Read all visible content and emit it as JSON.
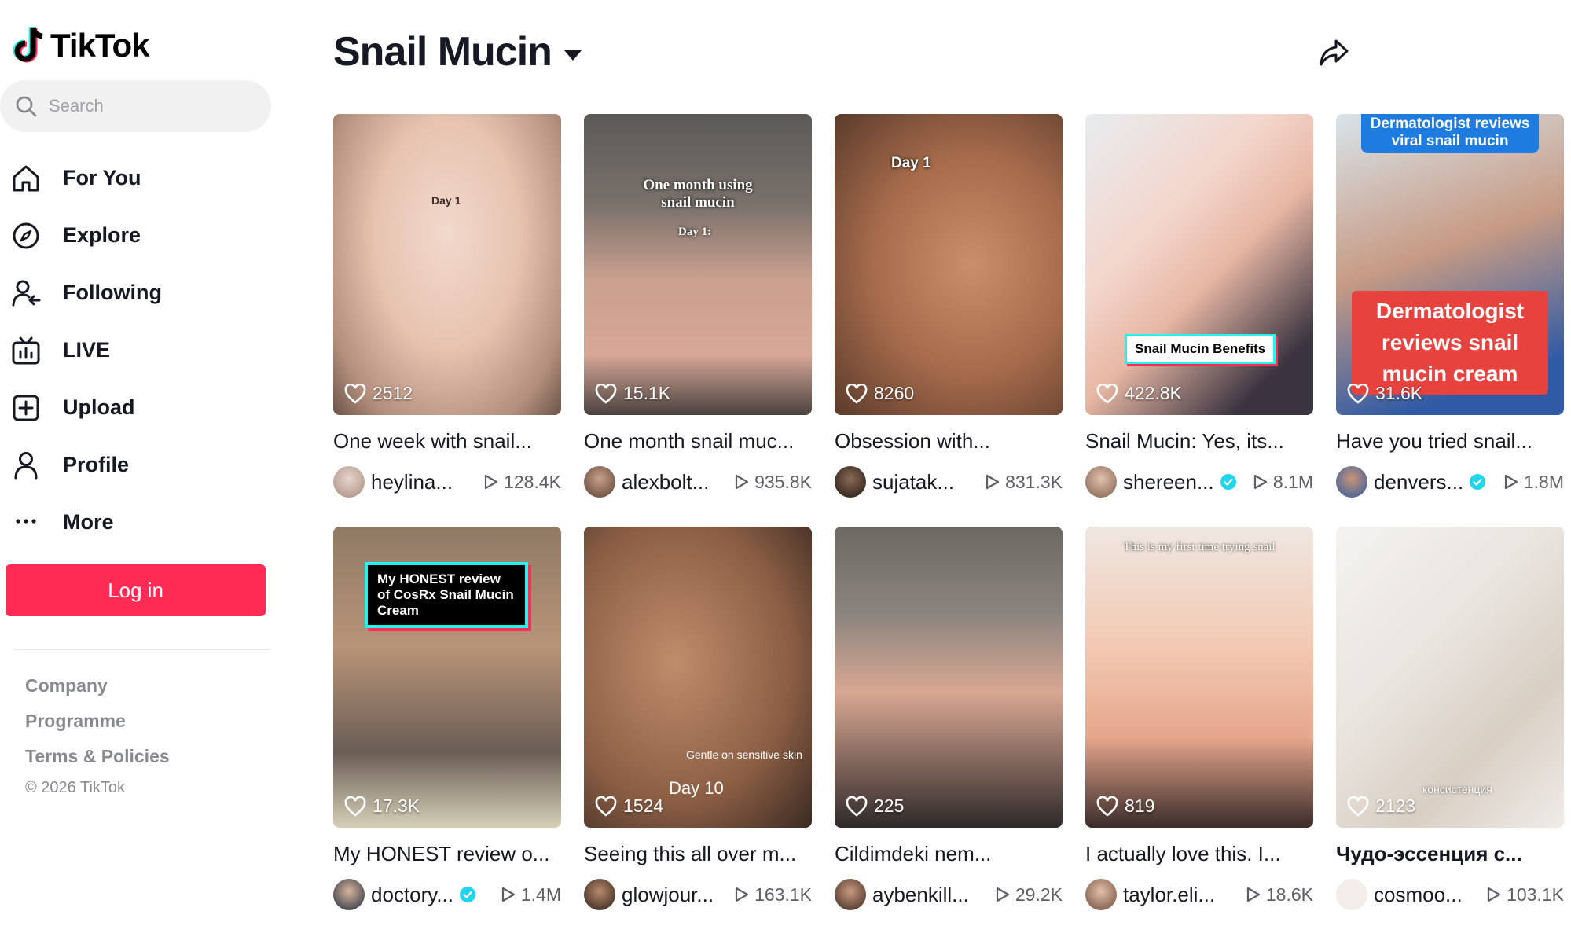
{
  "app": {
    "name": "TikTok"
  },
  "search": {
    "placeholder": "Search"
  },
  "nav": [
    {
      "label": "For You",
      "icon": "home-icon"
    },
    {
      "label": "Explore",
      "icon": "compass-icon"
    },
    {
      "label": "Following",
      "icon": "following-icon"
    },
    {
      "label": "LIVE",
      "icon": "live-tv-icon"
    },
    {
      "label": "Upload",
      "icon": "upload-plus-icon"
    },
    {
      "label": "Profile",
      "icon": "profile-icon"
    },
    {
      "label": "More",
      "icon": "more-dots-icon"
    }
  ],
  "login": {
    "label": "Log in"
  },
  "footer": {
    "links": [
      "Company",
      "Programme",
      "Terms & Policies"
    ],
    "copyright": "© 2026 TikTok"
  },
  "page": {
    "title": "Snail Mucin"
  },
  "colors": {
    "accent": "#fe2c55",
    "verified": "#20d5ec"
  },
  "videos": [
    {
      "likes": "2512",
      "title": "One week with snail...",
      "user": "heylina...",
      "verified": false,
      "views": "128.4K",
      "overlay": "Day 1"
    },
    {
      "likes": "15.1K",
      "title": "One month snail muc...",
      "user": "alexbolt...",
      "verified": false,
      "views": "935.8K",
      "overlay": "One month using snail mucin",
      "overlay2": "Day 1:"
    },
    {
      "likes": "8260",
      "title": "Obsession with...",
      "user": "sujatak...",
      "verified": false,
      "views": "831.3K",
      "overlay": "Day 1"
    },
    {
      "likes": "422.8K",
      "title": "Snail Mucin: Yes, its...",
      "user": "shereen...",
      "verified": true,
      "views": "8.1M",
      "overlay": "Snail Mucin Benefits"
    },
    {
      "likes": "31.6K",
      "title": "Have you tried snail...",
      "user": "denvers...",
      "verified": true,
      "views": "1.8M",
      "overlay": "Dermatologist reviews viral snail mucin",
      "overlay2": "Dermatologist reviews snail mucin cream"
    },
    {
      "likes": "17.3K",
      "title": "My HONEST review o...",
      "user": "doctory...",
      "verified": true,
      "views": "1.4M",
      "overlay": "My HONEST review of CosRx Snail Mucin Cream"
    },
    {
      "likes": "1524",
      "title": "Seeing this all over m...",
      "user": "glowjour...",
      "verified": false,
      "views": "163.1K",
      "overlay": "Gentle on sensitive skin",
      "overlay2": "Day 10"
    },
    {
      "likes": "225",
      "title": "Cildimdeki nem...",
      "user": "aybenkill...",
      "verified": false,
      "views": "29.2K",
      "overlay": ""
    },
    {
      "likes": "819",
      "title": "I actually love this. I...",
      "user": "taylor.eli...",
      "verified": false,
      "views": "18.6K",
      "overlay": "This is my first time trying snail"
    },
    {
      "likes": "2123",
      "title": "Чудо-эссенция с...",
      "user": "cosmoo...",
      "verified": false,
      "views": "103.1K",
      "overlay": "консистенция"
    }
  ]
}
